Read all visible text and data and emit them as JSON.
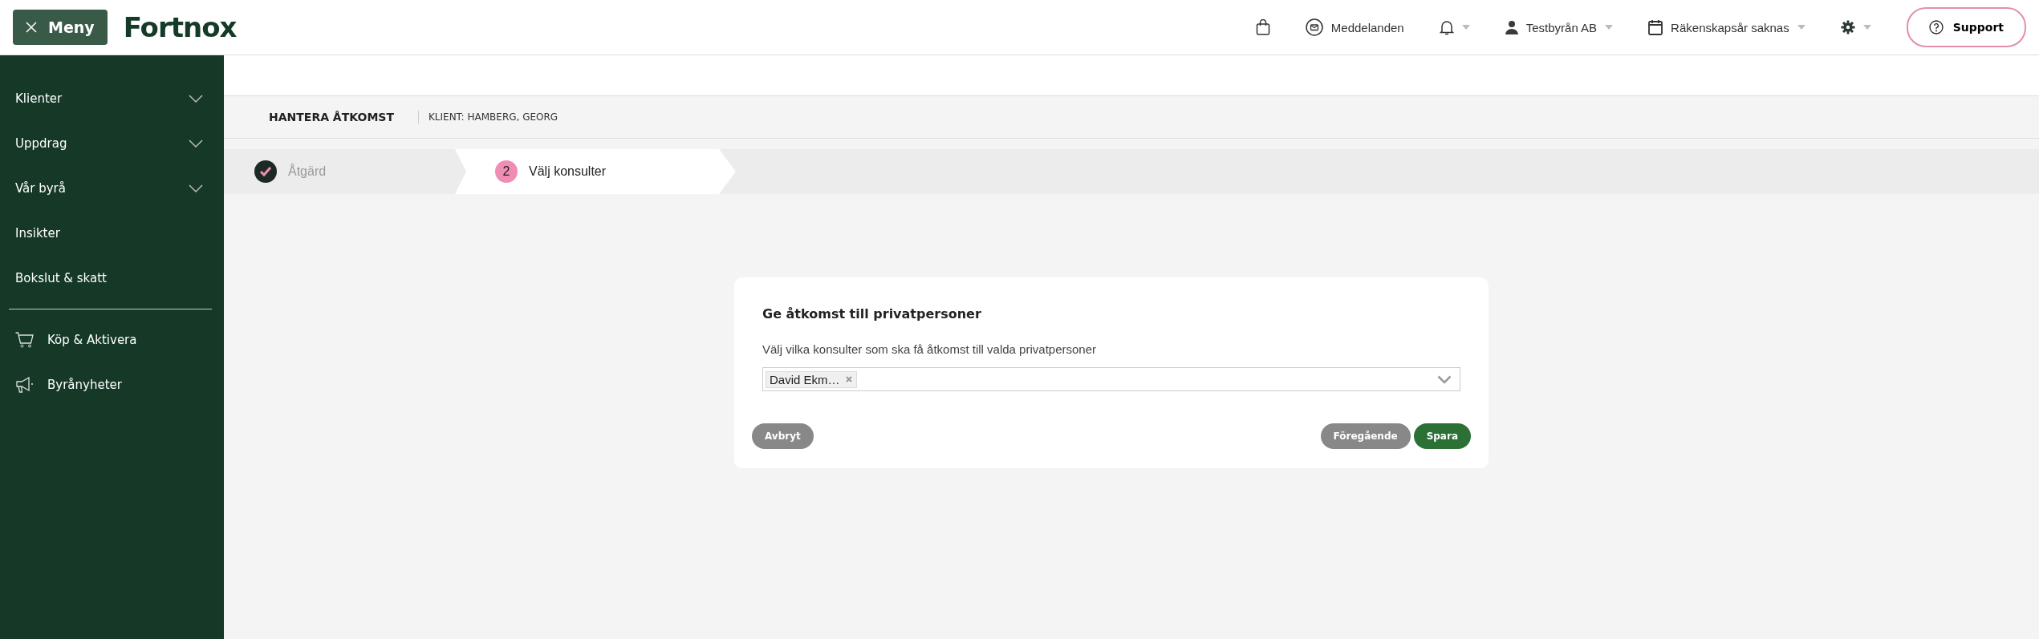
{
  "topbar": {
    "menu_button": "Meny",
    "logo": "Fortnox",
    "items": [
      {
        "kind": "bag"
      },
      {
        "kind": "mail",
        "label": "Meddelanden"
      },
      {
        "kind": "bell",
        "dropdown": true
      },
      {
        "kind": "user",
        "label": "Testbyrån AB",
        "dropdown": true
      },
      {
        "kind": "calendar",
        "label": "Räkenskapsår saknas",
        "dropdown": true
      },
      {
        "kind": "gear",
        "dropdown": true
      }
    ],
    "support": "Support"
  },
  "sidebar": {
    "items": [
      {
        "label": "Klienter",
        "kind": "group",
        "expanded": false
      },
      {
        "label": "Uppdrag",
        "kind": "group",
        "expanded": false
      },
      {
        "label": "Vår byrå",
        "kind": "group",
        "expanded": false
      },
      {
        "label": "Insikter",
        "kind": "link"
      },
      {
        "label": "Bokslut & skatt",
        "kind": "link"
      }
    ],
    "shortcuts": [
      {
        "label": "Köp & Aktivera",
        "kind": "cart"
      },
      {
        "label": "Byrånyheter",
        "kind": "megaphone"
      }
    ]
  },
  "header": {
    "title": "HANTERA ÅTKOMST",
    "client": "KLIENT: HAMBERG, GEORG"
  },
  "steps": [
    {
      "label": "Åtgärd",
      "done": true,
      "selected": false
    },
    {
      "number": "2",
      "label": "Välj konsulter",
      "done": false,
      "selected": true
    }
  ],
  "card": {
    "title": "Ge åtkomst till privatpersoner",
    "field_label": "Välj vilka konsulter som ska få åtkomst till valda privatpersoner",
    "tags": [
      "David Ekm…"
    ],
    "cancel": "Avbryt",
    "previous": "Föregående",
    "save": "Spara"
  }
}
